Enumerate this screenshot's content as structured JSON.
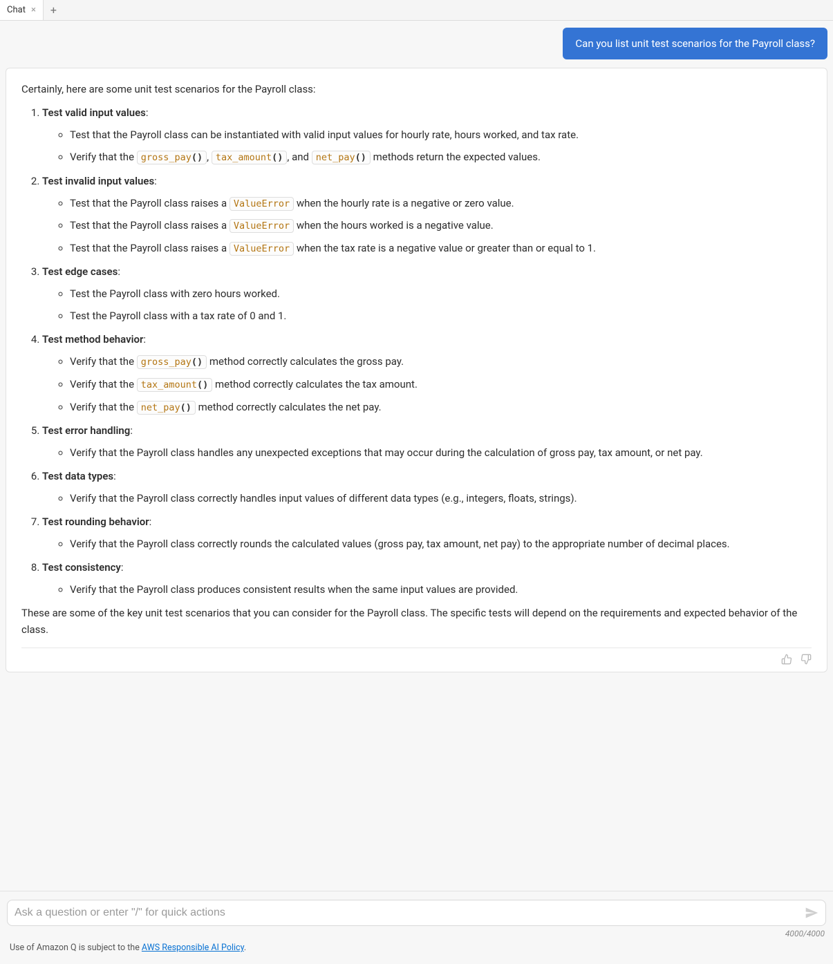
{
  "tabs": {
    "active_label": "Chat"
  },
  "user_message": "Can you list unit test scenarios for the Payroll class?",
  "assistant": {
    "intro": "Certainly, here are some unit test scenarios for the Payroll class:",
    "items": [
      {
        "title": "Test valid input values",
        "subs": [
          {
            "type": "text",
            "text": "Test that the Payroll class can be instantiated with valid input values for hourly rate, hours worked, and tax rate."
          },
          {
            "type": "methods3",
            "pre": "Verify that the ",
            "c1": "gross_pay",
            "mid1": ", ",
            "c2": "tax_amount",
            "mid2": ", and ",
            "c3": "net_pay",
            "post": " methods return the expected values."
          }
        ]
      },
      {
        "title": "Test invalid input values",
        "subs": [
          {
            "type": "code1",
            "pre": "Test that the Payroll class raises a ",
            "c1": "ValueError",
            "post": " when the hourly rate is a negative or zero value."
          },
          {
            "type": "code1",
            "pre": "Test that the Payroll class raises a ",
            "c1": "ValueError",
            "post": " when the hours worked is a negative value."
          },
          {
            "type": "code1",
            "pre": "Test that the Payroll class raises a ",
            "c1": "ValueError",
            "post": " when the tax rate is a negative value or greater than or equal to 1."
          }
        ]
      },
      {
        "title": "Test edge cases",
        "subs": [
          {
            "type": "text",
            "text": "Test the Payroll class with zero hours worked."
          },
          {
            "type": "text",
            "text": "Test the Payroll class with a tax rate of 0 and 1."
          }
        ]
      },
      {
        "title": "Test method behavior",
        "subs": [
          {
            "type": "method1",
            "pre": "Verify that the ",
            "c1": "gross_pay",
            "post": " method correctly calculates the gross pay."
          },
          {
            "type": "method1",
            "pre": "Verify that the ",
            "c1": "tax_amount",
            "post": " method correctly calculates the tax amount."
          },
          {
            "type": "method1",
            "pre": "Verify that the ",
            "c1": "net_pay",
            "post": " method correctly calculates the net pay."
          }
        ]
      },
      {
        "title": "Test error handling",
        "subs": [
          {
            "type": "text",
            "text": "Verify that the Payroll class handles any unexpected exceptions that may occur during the calculation of gross pay, tax amount, or net pay."
          }
        ]
      },
      {
        "title": "Test data types",
        "subs": [
          {
            "type": "text",
            "text": "Verify that the Payroll class correctly handles input values of different data types (e.g., integers, floats, strings)."
          }
        ]
      },
      {
        "title": "Test rounding behavior",
        "subs": [
          {
            "type": "text",
            "text": "Verify that the Payroll class correctly rounds the calculated values (gross pay, tax amount, net pay) to the appropriate number of decimal places."
          }
        ]
      },
      {
        "title": "Test consistency",
        "subs": [
          {
            "type": "text",
            "text": "Verify that the Payroll class produces consistent results when the same input values are provided."
          }
        ]
      }
    ],
    "outro": "These are some of the key unit test scenarios that you can consider for the Payroll class. The specific tests will depend on the requirements and expected behavior of the class."
  },
  "input": {
    "placeholder": "Ask a question or enter \"/\" for quick actions",
    "char_count": "4000/4000"
  },
  "policy": {
    "prefix": "Use of Amazon Q is subject to the ",
    "link_text": "AWS Responsible AI Policy",
    "suffix": "."
  }
}
